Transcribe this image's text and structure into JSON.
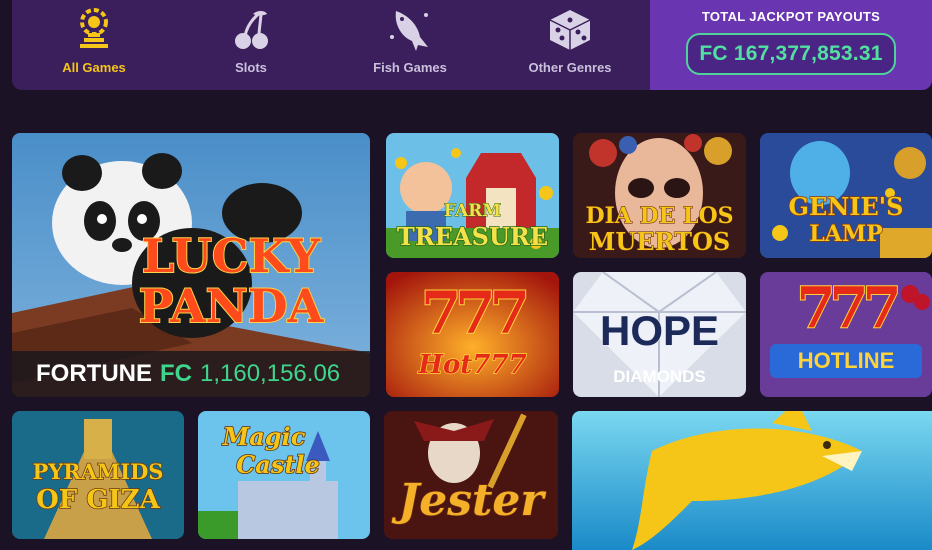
{
  "categories": [
    {
      "label": "All Games",
      "icon": "casino-chip-icon",
      "active": true
    },
    {
      "label": "Slots",
      "icon": "cherries-icon",
      "active": false
    },
    {
      "label": "Fish Games",
      "icon": "fish-icon",
      "active": false
    },
    {
      "label": "Other Genres",
      "icon": "dice-icon",
      "active": false
    }
  ],
  "jackpot": {
    "title": "TOTAL JACKPOT PAYOUTS",
    "amount": "FC 167,377,853.31"
  },
  "featured": {
    "title_line1": "LUCKY",
    "title_line2": "PANDA",
    "fortune_label": "FORTUNE",
    "fortune_currency": "FC",
    "fortune_amount": "1,160,156.06"
  },
  "games": [
    {
      "line1": "FARM",
      "line2": "TREASURE"
    },
    {
      "line1": "DIA DE LOS",
      "line2": "MUERTOS"
    },
    {
      "line1": "GENIE'S",
      "line2": "LAMP"
    },
    {
      "line1": "777",
      "line2": "Hot777"
    },
    {
      "line1": "HOPE",
      "line2": "DIAMONDS"
    },
    {
      "line1": "777",
      "line2": "HOTLINE"
    },
    {
      "line1": "PYRAMIDS",
      "line2": "OF GIZA"
    },
    {
      "line1": "Magic",
      "line2": "Castle"
    },
    {
      "line1": "Jester",
      "line2": ""
    }
  ],
  "colors": {
    "background": "#1b1226",
    "category_bar": "#3a1f5c",
    "jackpot_panel": "#6a35b0",
    "active_label": "#f5c518",
    "jackpot_green": "#52e0a0"
  }
}
